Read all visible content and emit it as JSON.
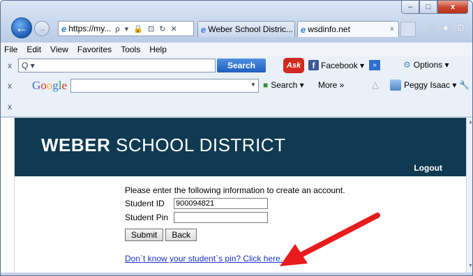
{
  "browser": {
    "window_buttons": {
      "minimize": "–",
      "maximize": "□",
      "close": "x"
    },
    "address": {
      "url": "https://my...",
      "tools": "ρ ▾ 🔒 ⊡ ↻ ✕"
    },
    "tabs": [
      {
        "label": "Weber School Distric..."
      },
      {
        "label": "wsdinfo.net",
        "close": "×"
      }
    ],
    "nav_icons": {
      "home": "⌂",
      "favorites": "★",
      "tools": "⚙"
    },
    "menu": [
      "File",
      "Edit",
      "View",
      "Favorites",
      "Tools",
      "Help"
    ],
    "toolbar1": {
      "close": "x",
      "search_placeholder": "Q ▾",
      "search_button": "Search",
      "ask_logo": "Ask",
      "facebook": "Facebook ▾",
      "more": "»",
      "options": "Options ▾"
    },
    "toolbar2": {
      "close": "x",
      "google": "Google",
      "search": "Search ▾",
      "more": "More »",
      "user": "Peggy Isaac ▾"
    },
    "toolbar3": {
      "close": "x"
    }
  },
  "page": {
    "brand_bold": "WEBER",
    "brand_rest": " SCHOOL DISTRICT",
    "logout": "Logout",
    "intro": "Please enter the following information to create an account.",
    "fields": [
      {
        "label": "Student ID",
        "value": "900094821"
      },
      {
        "label": "Student Pin",
        "value": ""
      }
    ],
    "submit": "Submit",
    "back": "Back",
    "help_link": "Don`t know your student`s pin? Click here."
  },
  "colors": {
    "banner": "#0f3a52",
    "arrow": "#e81c1c",
    "link": "#1a33c9"
  }
}
